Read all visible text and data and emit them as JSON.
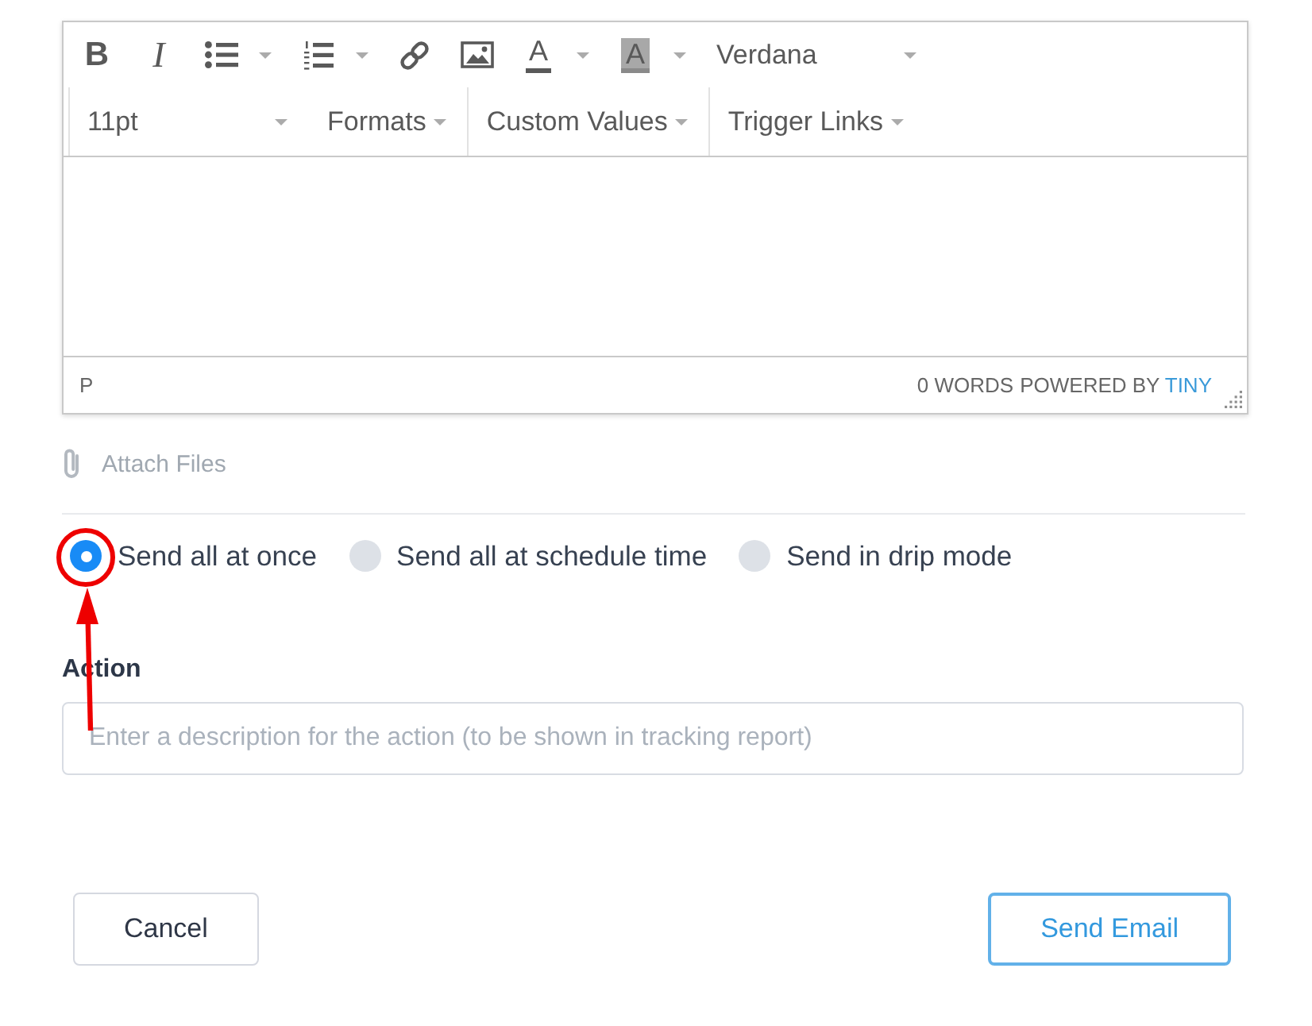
{
  "editor": {
    "toolbar": [
      {
        "groups": [
          [
            {
              "kind": "bold",
              "glyph": "B"
            },
            {
              "kind": "italic",
              "glyph": "I"
            },
            {
              "kind": "bullist",
              "menu": true
            },
            {
              "kind": "numlist",
              "menu": true
            },
            {
              "kind": "link"
            },
            {
              "kind": "image"
            },
            {
              "kind": "forecolor",
              "glyph": "A",
              "menu": true
            },
            {
              "kind": "backcolor",
              "glyph": "A",
              "menu": true
            },
            {
              "kind": "listbox",
              "value": "Verdana"
            }
          ]
        ]
      },
      {
        "groups": [
          [
            {
              "kind": "listbox",
              "value": "11pt"
            },
            {
              "kind": "menubutton",
              "value": "Formats"
            }
          ],
          [
            {
              "kind": "menubutton",
              "value": "Custom Values"
            }
          ],
          [
            {
              "kind": "menubutton",
              "value": "Trigger Links"
            }
          ]
        ]
      }
    ],
    "status_bar": {
      "path": "P",
      "word_count": "0 WORDS",
      "branding": "POWERED BY",
      "branding_link": "TINY"
    }
  },
  "attach": {
    "label": "Attach Files"
  },
  "send_modes": [
    {
      "label": "Send all at once",
      "selected": true,
      "highlighted": true
    },
    {
      "label": "Send all at schedule time",
      "selected": false,
      "highlighted": false
    },
    {
      "label": "Send in drip mode",
      "selected": false,
      "highlighted": false
    }
  ],
  "action": {
    "label": "Action",
    "placeholder": "Enter a description for the action (to be shown in tracking report)"
  },
  "buttons": [
    {
      "label": "Cancel",
      "kind": "secondary"
    },
    {
      "label": "Send Email",
      "kind": "primary"
    }
  ]
}
